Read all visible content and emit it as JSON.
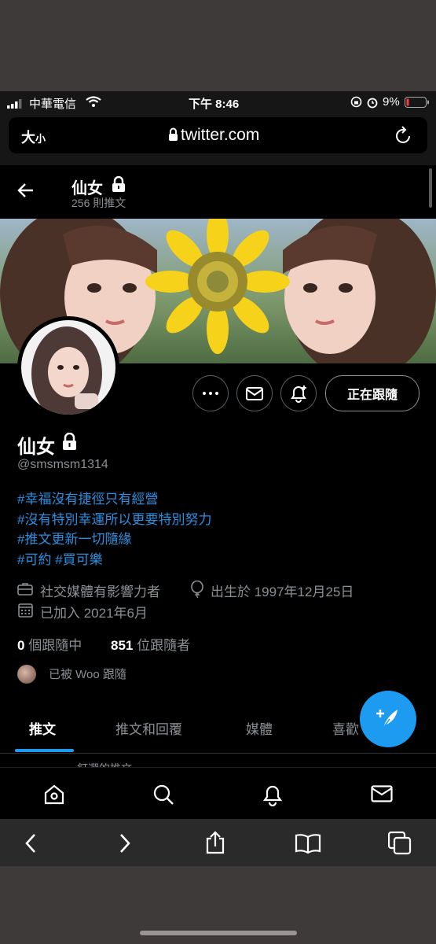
{
  "status_bar": {
    "carrier": "中華電信",
    "time": "下午 8:46",
    "battery": "9%"
  },
  "url_bar": {
    "text_size_label": "大",
    "text_size_small": "小",
    "url": "twitter.com"
  },
  "header": {
    "name": "仙女",
    "tweet_count": "256 則推文"
  },
  "profile": {
    "name": "仙女",
    "handle": "@smsmsm1314",
    "bio": [
      "#幸福沒有捷徑只有經營",
      "#沒有特別幸運所以更要特別努力",
      "#推文更新一切隨緣"
    ],
    "bio_tags_last": [
      "#可約",
      "#買可樂"
    ],
    "category": "社交媒體有影響力者",
    "birthday": "出生於 1997年12月25日",
    "joined": "已加入 2021年6月",
    "following_count": "0",
    "following_label": "個跟隨中",
    "followers_count": "851",
    "followers_label": "位跟隨者",
    "followed_by": "已被 Woo 跟隨",
    "follow_button": "正在跟隨"
  },
  "tabs": [
    "推文",
    "推文和回覆",
    "媒體",
    "喜歡"
  ],
  "pinned_partial": "釘選的推文",
  "colors": {
    "accent": "#1d9bf0",
    "link": "#2b8fe0",
    "background": "#000000"
  }
}
